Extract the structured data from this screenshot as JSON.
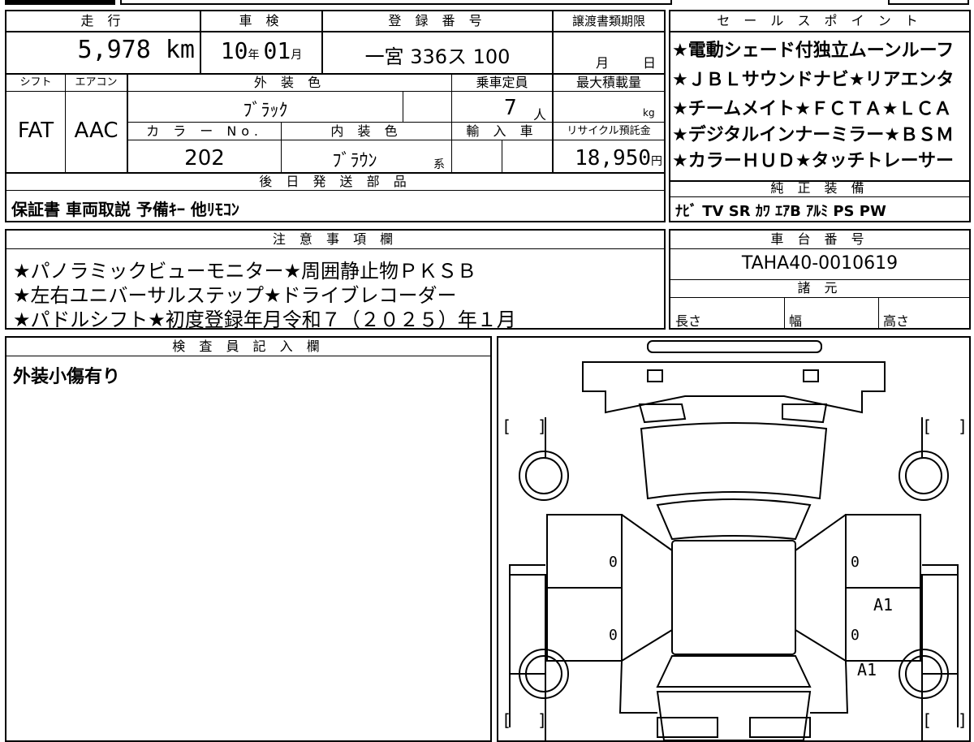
{
  "vehicle": {
    "mileage_label": "走 行",
    "mileage_value": "5,978 km",
    "inspection_label": "車 検",
    "inspection_year": "10",
    "inspection_year_unit": "年",
    "inspection_month": "01",
    "inspection_month_unit": "月",
    "registration_label": "登 録 番 号",
    "registration_value": "一宮 336ス 100",
    "transfer_label": "譲渡書類期限",
    "transfer_month_unit": "月",
    "transfer_day_unit": "日",
    "shift_label": "シフト",
    "shift_value": "FAT",
    "aircon_label": "エアコン",
    "aircon_value": "AAC",
    "exterior_color_label": "外 装 色",
    "exterior_color_value": "ﾌﾞﾗｯｸ",
    "capacity_label": "乗車定員",
    "capacity_value": "7",
    "capacity_unit": "人",
    "max_load_label": "最大積載量",
    "max_load_unit": "kg",
    "color_no_label": "カ ラ ー No.",
    "color_no_value": "202",
    "interior_color_label": "内 装 色",
    "interior_color_value": "ﾌﾞﾗｳﾝ",
    "interior_color_suffix": "系",
    "import_label": "輸 入 車",
    "recycle_label": "リサイクル預託金",
    "recycle_value": "18,950",
    "recycle_unit": "円"
  },
  "later_parts": {
    "label": "後 日 発 送 部 品",
    "value": "保証書 車両取説 予備ｷｰ 他ﾘﾓｺﾝ"
  },
  "sales_points": {
    "label": "セ ー ル ス ポ イ ン ト",
    "lines": [
      "★電動シェード付独立ムーンルーフ",
      "★ＪＢＬサウンドナビ★リアエンタ",
      "★チームメイト★ＦＣＴＡ★ＬＣＡ",
      "★デジタルインナーミラー★ＢＳＭ",
      "★カラーＨＵＤ★タッチトレーサー"
    ]
  },
  "equipment": {
    "label": "純 正 装 備",
    "value": "ﾅﾋﾞ TV SR ｶﾜ ｴｱB ｱﾙﾐ PS PW"
  },
  "notes": {
    "label": "注 意 事 項 欄",
    "lines": [
      "★パノラミックビューモニター★周囲静止物ＰＫＳＢ",
      "★左右ユニバーサルステップ★ドライブレコーダー",
      "★パドルシフト★初度登録年月令和７（２０２５）年１月"
    ]
  },
  "chassis": {
    "label": "車 台 番 号",
    "value": "TAHA40-0010619"
  },
  "specs": {
    "label": "諸 元",
    "length_label": "長さ",
    "width_label": "幅",
    "height_label": "高さ"
  },
  "inspector": {
    "label": "検 査 員 記 入 欄",
    "comment": "外装小傷有り"
  },
  "diagram": {
    "bracket_left": "[",
    "bracket_right": "]",
    "zero": "0",
    "marks": [
      "A1",
      "A1"
    ]
  }
}
